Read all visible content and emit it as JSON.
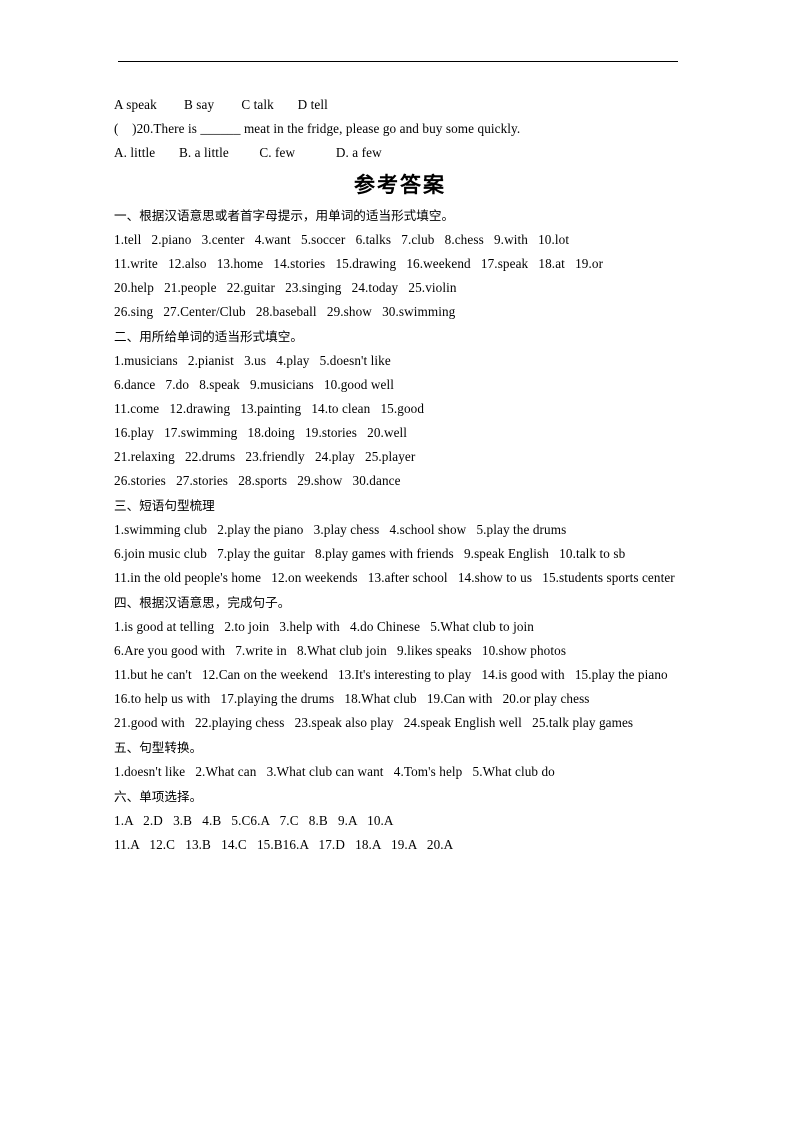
{
  "document": {
    "title": "参考答案",
    "header_rule": true
  },
  "carryover": {
    "options_line": "A speak        B say        C talk       D tell",
    "question_20": "(    )20.There is ______ meat in the fridge, please go and buy some quickly.",
    "question_20_options": "A. little       B. a little         C. few            D. a few"
  },
  "sections": [
    {
      "heading": "一、根据汉语意思或者首字母提示，用单词的适当形式填空。",
      "lines": [
        "1.tell   2.piano   3.center   4.want   5.soccer   6.talks   7.club   8.chess   9.with   10.lot",
        "11.write   12.also   13.home   14.stories   15.drawing   16.weekend   17.speak   18.at   19.or",
        "20.help   21.people   22.guitar   23.singing   24.today   25.violin",
        "26.sing   27.Center/Club   28.baseball   29.show   30.swimming"
      ]
    },
    {
      "heading": "二、用所给单词的适当形式填空。",
      "lines": [
        "1.musicians   2.pianist   3.us   4.play   5.doesn't like",
        "6.dance   7.do   8.speak   9.musicians   10.good well",
        "11.come   12.drawing   13.painting   14.to clean   15.good",
        "16.play   17.swimming   18.doing   19.stories   20.well",
        "21.relaxing   22.drums   23.friendly   24.play   25.player",
        "26.stories   27.stories   28.sports   29.show   30.dance"
      ]
    },
    {
      "heading": "三、短语句型梳理",
      "lines": [
        "1.swimming club   2.play the piano   3.play chess   4.school show   5.play the drums",
        "6.join music club   7.play the guitar   8.play games with friends   9.speak English   10.talk to sb",
        "11.in the old people's home   12.on weekends   13.after school   14.show to us   15.students sports center"
      ]
    },
    {
      "heading": "四、根据汉语意思，完成句子。",
      "lines": [
        "1.is good at telling   2.to join   3.help with   4.do Chinese   5.What club to join",
        "6.Are you good with   7.write in   8.What club join   9.likes speaks   10.show photos",
        "11.but he can't   12.Can on the weekend   13.It's interesting to play   14.is good with   15.play the piano",
        "16.to help us with   17.playing the drums   18.What club   19.Can with   20.or play chess",
        "21.good with   22.playing chess   23.speak also play   24.speak English well   25.talk play games"
      ]
    },
    {
      "heading": "五、句型转换。",
      "lines": [
        "1.doesn't like   2.What can   3.What club can want   4.Tom's help   5.What club do"
      ]
    },
    {
      "heading": "六、单项选择。",
      "lines": [
        "1.A   2.D   3.B   4.B   5.C6.A   7.C   8.B   9.A   10.A",
        "11.A   12.C   13.B   14.C   15.B16.A   17.D   18.A   19.A   20.A"
      ]
    }
  ]
}
